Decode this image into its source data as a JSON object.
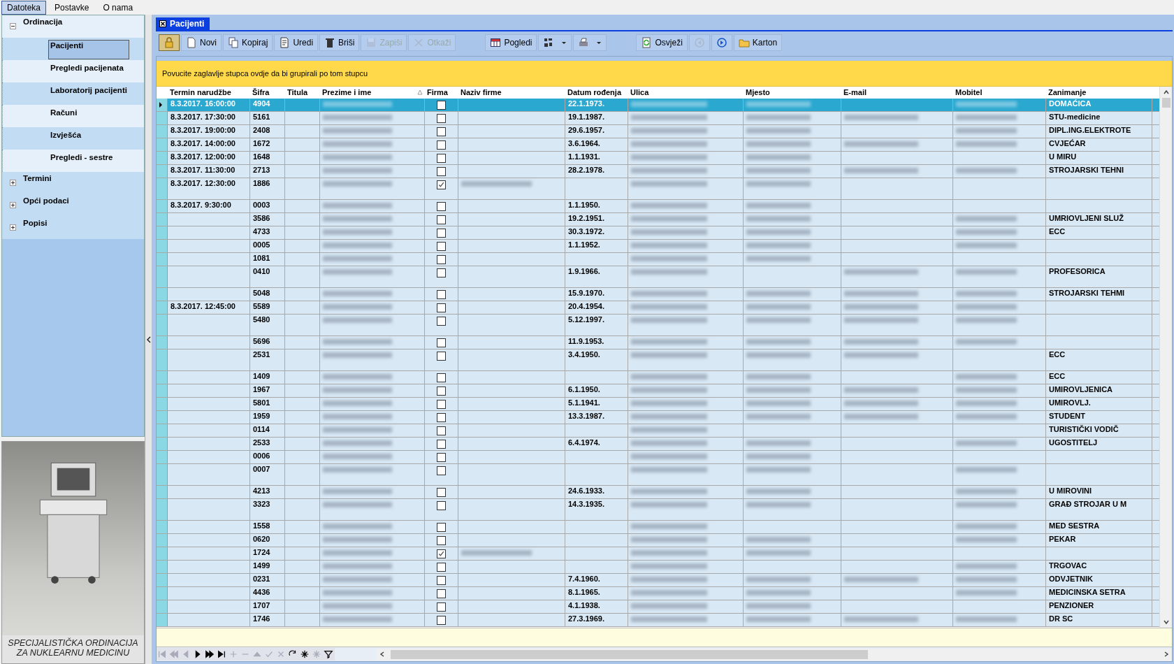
{
  "menu": [
    {
      "label": "Datoteka",
      "selected": true
    },
    {
      "label": "Postavke",
      "selected": false
    },
    {
      "label": "O nama",
      "selected": false
    }
  ],
  "tree": [
    {
      "label": "Ordinacija",
      "expanded": true,
      "children": [
        {
          "label": "Pacijenti",
          "selected": true
        },
        {
          "label": "Pregledi pacijenata",
          "selected": false
        },
        {
          "label": "Laboratorij pacijenti",
          "selected": false
        },
        {
          "label": "Računi",
          "selected": false
        },
        {
          "label": "Izvješća",
          "selected": false
        },
        {
          "label": "Pregledi - sestre",
          "selected": false
        }
      ]
    },
    {
      "label": "Termini",
      "expanded": false
    },
    {
      "label": "Opći podaci",
      "expanded": false
    },
    {
      "label": "Popisi",
      "expanded": false
    }
  ],
  "caption": "SPECIJALISTIČKA ORDINACIJA ZA NUKLEARNU MEDICINU",
  "tab": {
    "title": "Pacijenti"
  },
  "toolbar": [
    {
      "kind": "lock",
      "disabled": false,
      "pressed": true
    },
    {
      "kind": "new",
      "label": "Novi",
      "disabled": false,
      "pressed": false
    },
    {
      "kind": "copy",
      "label": "Kopiraj",
      "disabled": false,
      "pressed": false
    },
    {
      "kind": "edit",
      "label": "Uredi",
      "disabled": false,
      "pressed": false
    },
    {
      "kind": "delete",
      "label": "Briši",
      "disabled": false,
      "pressed": false
    },
    {
      "kind": "save",
      "label": "Zapiši",
      "disabled": true,
      "pressed": false
    },
    {
      "kind": "cancel",
      "label": "Otkaži",
      "disabled": true,
      "pressed": false
    },
    {
      "kind": "views",
      "label": "Pogledi",
      "disabled": false,
      "pressed": false
    },
    {
      "kind": "columns",
      "disabled": false,
      "pressed": false,
      "menu": true
    },
    {
      "kind": "print",
      "disabled": false,
      "pressed": false,
      "menu": true
    },
    {
      "kind": "refresh",
      "label": "Osvježi",
      "disabled": false,
      "pressed": false
    },
    {
      "kind": "prev",
      "disabled": true,
      "pressed": false
    },
    {
      "kind": "next",
      "disabled": false,
      "pressed": false
    },
    {
      "kind": "folder",
      "label": "Karton",
      "disabled": false,
      "pressed": false
    }
  ],
  "group_hint": "Povucite zaglavlje stupca ovdje da bi grupirali po tom stupcu",
  "columns": [
    {
      "label": "Termin narudžbe",
      "sorted": false
    },
    {
      "label": "Šifra",
      "sorted": false
    },
    {
      "label": "Titula",
      "sorted": false
    },
    {
      "label": "Prezime i ime",
      "sorted": true
    },
    {
      "label": "Firma",
      "sorted": false
    },
    {
      "label": "Naziv firme",
      "sorted": false
    },
    {
      "label": "Datum rođenja",
      "sorted": false
    },
    {
      "label": "Ulica",
      "sorted": false
    },
    {
      "label": "Mjesto",
      "sorted": false
    },
    {
      "label": "E-mail",
      "sorted": false
    },
    {
      "label": "Mobitel",
      "sorted": false
    },
    {
      "label": "Zanimanje",
      "sorted": false
    }
  ],
  "rows": [
    {
      "selected": true,
      "tall": false,
      "cells": [
        "8.3.2017. 16:00:00",
        "4904",
        null,
        {
          "redacted": true
        },
        {
          "checked": false
        },
        null,
        "22.1.1973.",
        {
          "redacted": true
        },
        {
          "redacted": true
        },
        null,
        {
          "redacted": true
        },
        "DOMAĆICA"
      ]
    },
    {
      "selected": false,
      "tall": false,
      "cells": [
        "8.3.2017. 17:30:00",
        "5161",
        null,
        {
          "redacted": true
        },
        {
          "checked": false
        },
        null,
        "19.1.1987.",
        {
          "redacted": true
        },
        {
          "redacted": true
        },
        {
          "redacted": true
        },
        {
          "redacted": true
        },
        "STU-medicine"
      ]
    },
    {
      "selected": false,
      "tall": false,
      "cells": [
        "8.3.2017. 19:00:00",
        "2408",
        null,
        {
          "redacted": true
        },
        {
          "checked": false
        },
        null,
        "29.6.1957.",
        {
          "redacted": true
        },
        {
          "redacted": true
        },
        null,
        {
          "redacted": true
        },
        "DIPL.ING.ELEKTROTE"
      ]
    },
    {
      "selected": false,
      "tall": false,
      "cells": [
        "8.3.2017. 14:00:00",
        "1672",
        null,
        {
          "redacted": true
        },
        {
          "checked": false
        },
        null,
        "3.6.1964.",
        {
          "redacted": true
        },
        {
          "redacted": true
        },
        {
          "redacted": true
        },
        {
          "redacted": true
        },
        "CVJEĆAR"
      ]
    },
    {
      "selected": false,
      "tall": false,
      "cells": [
        "8.3.2017. 12:00:00",
        "1648",
        null,
        {
          "redacted": true
        },
        {
          "checked": false
        },
        null,
        "1.1.1931.",
        {
          "redacted": true
        },
        {
          "redacted": true
        },
        null,
        null,
        "U MIRU"
      ]
    },
    {
      "selected": false,
      "tall": false,
      "cells": [
        "8.3.2017. 11:30:00",
        "2713",
        null,
        {
          "redacted": true
        },
        {
          "checked": false
        },
        null,
        "28.2.1978.",
        {
          "redacted": true
        },
        {
          "redacted": true
        },
        {
          "redacted": true
        },
        {
          "redacted": true
        },
        "STROJARSKI TEHNI"
      ]
    },
    {
      "selected": false,
      "tall": true,
      "cells": [
        "8.3.2017. 12:30:00",
        "1886",
        null,
        {
          "redacted": true
        },
        {
          "checked": true
        },
        {
          "redacted": true
        },
        null,
        {
          "redacted": true
        },
        {
          "redacted": true
        },
        null,
        null,
        null
      ]
    },
    {
      "selected": false,
      "tall": false,
      "cells": [
        "8.3.2017. 9:30:00",
        "0003",
        null,
        {
          "redacted": true
        },
        {
          "checked": false
        },
        null,
        "1.1.1950.",
        {
          "redacted": true
        },
        {
          "redacted": true
        },
        null,
        null,
        null
      ]
    },
    {
      "selected": false,
      "tall": false,
      "cells": [
        null,
        "3586",
        null,
        {
          "redacted": true
        },
        {
          "checked": false
        },
        null,
        "19.2.1951.",
        {
          "redacted": true
        },
        {
          "redacted": true
        },
        null,
        {
          "redacted": true
        },
        "UMRIOVLJENI SLUŽ"
      ]
    },
    {
      "selected": false,
      "tall": false,
      "cells": [
        null,
        "4733",
        null,
        {
          "redacted": true
        },
        {
          "checked": false
        },
        null,
        "30.3.1972.",
        {
          "redacted": true
        },
        {
          "redacted": true
        },
        null,
        {
          "redacted": true
        },
        "ECC"
      ]
    },
    {
      "selected": false,
      "tall": false,
      "cells": [
        null,
        "0005",
        null,
        {
          "redacted": true
        },
        {
          "checked": false
        },
        null,
        "1.1.1952.",
        {
          "redacted": true
        },
        {
          "redacted": true
        },
        null,
        {
          "redacted": true
        },
        null
      ]
    },
    {
      "selected": false,
      "tall": false,
      "cells": [
        null,
        "1081",
        null,
        {
          "redacted": true
        },
        {
          "checked": false
        },
        null,
        null,
        {
          "redacted": true
        },
        {
          "redacted": true
        },
        null,
        null,
        null
      ]
    },
    {
      "selected": false,
      "tall": true,
      "cells": [
        null,
        "0410",
        null,
        {
          "redacted": true
        },
        {
          "checked": false
        },
        null,
        "1.9.1966.",
        {
          "redacted": true
        },
        null,
        {
          "redacted": true
        },
        {
          "redacted": true
        },
        "PROFESORICA"
      ]
    },
    {
      "selected": false,
      "tall": false,
      "cells": [
        null,
        "5048",
        null,
        {
          "redacted": true
        },
        {
          "checked": false
        },
        null,
        "15.9.1970.",
        {
          "redacted": true
        },
        {
          "redacted": true
        },
        {
          "redacted": true
        },
        {
          "redacted": true
        },
        "STROJARSKI TEHMI"
      ]
    },
    {
      "selected": false,
      "tall": false,
      "cells": [
        "8.3.2017. 12:45:00",
        "5589",
        null,
        {
          "redacted": true
        },
        {
          "checked": false
        },
        null,
        "20.4.1954.",
        {
          "redacted": true
        },
        {
          "redacted": true
        },
        {
          "redacted": true
        },
        {
          "redacted": true
        },
        null
      ]
    },
    {
      "selected": false,
      "tall": true,
      "cells": [
        null,
        "5480",
        null,
        {
          "redacted": true
        },
        {
          "checked": false
        },
        null,
        "5.12.1997.",
        {
          "redacted": true
        },
        {
          "redacted": true
        },
        {
          "redacted": true
        },
        {
          "redacted": true
        },
        null
      ]
    },
    {
      "selected": false,
      "tall": false,
      "cells": [
        null,
        "5696",
        null,
        {
          "redacted": true
        },
        {
          "checked": false
        },
        null,
        "11.9.1953.",
        {
          "redacted": true
        },
        {
          "redacted": true
        },
        {
          "redacted": true
        },
        {
          "redacted": true
        },
        null
      ]
    },
    {
      "selected": false,
      "tall": true,
      "cells": [
        null,
        "2531",
        null,
        {
          "redacted": true
        },
        {
          "checked": false
        },
        null,
        "3.4.1950.",
        {
          "redacted": true
        },
        {
          "redacted": true
        },
        {
          "redacted": true
        },
        null,
        "ECC"
      ]
    },
    {
      "selected": false,
      "tall": false,
      "cells": [
        null,
        "1409",
        null,
        {
          "redacted": true
        },
        {
          "checked": false
        },
        null,
        null,
        {
          "redacted": true
        },
        {
          "redacted": true
        },
        null,
        {
          "redacted": true
        },
        "ECC"
      ]
    },
    {
      "selected": false,
      "tall": false,
      "cells": [
        null,
        "1967",
        null,
        {
          "redacted": true
        },
        {
          "checked": false
        },
        null,
        "6.1.1950.",
        {
          "redacted": true
        },
        {
          "redacted": true
        },
        {
          "redacted": true
        },
        {
          "redacted": true
        },
        "UMIROVLJENICA"
      ]
    },
    {
      "selected": false,
      "tall": false,
      "cells": [
        null,
        "5801",
        null,
        {
          "redacted": true
        },
        {
          "checked": false
        },
        null,
        "5.1.1941.",
        {
          "redacted": true
        },
        {
          "redacted": true
        },
        {
          "redacted": true
        },
        {
          "redacted": true
        },
        "UMIROVLJ."
      ]
    },
    {
      "selected": false,
      "tall": false,
      "cells": [
        null,
        "1959",
        null,
        {
          "redacted": true
        },
        {
          "checked": false
        },
        null,
        "13.3.1987.",
        {
          "redacted": true
        },
        {
          "redacted": true
        },
        {
          "redacted": true
        },
        {
          "redacted": true
        },
        "STUDENT"
      ]
    },
    {
      "selected": false,
      "tall": false,
      "cells": [
        null,
        "0114",
        null,
        {
          "redacted": true
        },
        {
          "checked": false
        },
        null,
        null,
        {
          "redacted": true
        },
        null,
        null,
        null,
        "TURISTIČKI VODIČ"
      ]
    },
    {
      "selected": false,
      "tall": false,
      "cells": [
        null,
        "2533",
        null,
        {
          "redacted": true
        },
        {
          "checked": false
        },
        null,
        "6.4.1974.",
        {
          "redacted": true
        },
        {
          "redacted": true
        },
        null,
        {
          "redacted": true
        },
        "UGOSTITELJ"
      ]
    },
    {
      "selected": false,
      "tall": false,
      "cells": [
        null,
        "0006",
        null,
        {
          "redacted": true
        },
        {
          "checked": false
        },
        null,
        null,
        {
          "redacted": true
        },
        {
          "redacted": true
        },
        null,
        null,
        null
      ]
    },
    {
      "selected": false,
      "tall": true,
      "cells": [
        null,
        "0007",
        null,
        {
          "redacted": true
        },
        {
          "checked": false
        },
        null,
        null,
        {
          "redacted": true
        },
        {
          "redacted": true
        },
        null,
        {
          "redacted": true
        },
        null
      ]
    },
    {
      "selected": false,
      "tall": false,
      "cells": [
        null,
        "4213",
        null,
        {
          "redacted": true
        },
        {
          "checked": false
        },
        null,
        "24.6.1933.",
        {
          "redacted": true
        },
        {
          "redacted": true
        },
        null,
        {
          "redacted": true
        },
        "U MIROVINI"
      ]
    },
    {
      "selected": false,
      "tall": true,
      "cells": [
        null,
        "3323",
        null,
        {
          "redacted": true
        },
        {
          "checked": false
        },
        null,
        "14.3.1935.",
        {
          "redacted": true
        },
        {
          "redacted": true
        },
        null,
        {
          "redacted": true
        },
        "GRAĐ STROJAR U M"
      ]
    },
    {
      "selected": false,
      "tall": false,
      "cells": [
        null,
        "1558",
        null,
        {
          "redacted": true
        },
        {
          "checked": false
        },
        null,
        null,
        {
          "redacted": true
        },
        null,
        null,
        {
          "redacted": true
        },
        "MED SESTRA"
      ]
    },
    {
      "selected": false,
      "tall": false,
      "cells": [
        null,
        "0620",
        null,
        {
          "redacted": true
        },
        {
          "checked": false
        },
        null,
        null,
        {
          "redacted": true
        },
        {
          "redacted": true
        },
        null,
        {
          "redacted": true
        },
        "PEKAR"
      ]
    },
    {
      "selected": false,
      "tall": false,
      "cells": [
        null,
        "1724",
        null,
        {
          "redacted": true
        },
        {
          "checked": true
        },
        {
          "redacted": true
        },
        null,
        {
          "redacted": true
        },
        {
          "redacted": true
        },
        null,
        null,
        null
      ]
    },
    {
      "selected": false,
      "tall": false,
      "cells": [
        null,
        "1499",
        null,
        {
          "redacted": true
        },
        {
          "checked": false
        },
        null,
        null,
        {
          "redacted": true
        },
        null,
        null,
        {
          "redacted": true
        },
        "TRGOVAC"
      ]
    },
    {
      "selected": false,
      "tall": false,
      "cells": [
        null,
        "0231",
        null,
        {
          "redacted": true
        },
        {
          "checked": false
        },
        null,
        "7.4.1960.",
        {
          "redacted": true
        },
        {
          "redacted": true
        },
        {
          "redacted": true
        },
        {
          "redacted": true
        },
        "ODVJETNIK"
      ]
    },
    {
      "selected": false,
      "tall": false,
      "cells": [
        null,
        "4436",
        null,
        {
          "redacted": true
        },
        {
          "checked": false
        },
        null,
        "8.1.1965.",
        {
          "redacted": true
        },
        {
          "redacted": true
        },
        null,
        {
          "redacted": true
        },
        "MEDICINSKA SETRA"
      ]
    },
    {
      "selected": false,
      "tall": false,
      "cells": [
        null,
        "1707",
        null,
        {
          "redacted": true
        },
        {
          "checked": false
        },
        null,
        "4.1.1938.",
        {
          "redacted": true
        },
        {
          "redacted": true
        },
        null,
        null,
        "PENZIONER"
      ]
    },
    {
      "selected": false,
      "tall": false,
      "cells": [
        null,
        "1746",
        null,
        {
          "redacted": true
        },
        {
          "checked": false
        },
        null,
        "27.3.1969.",
        {
          "redacted": true
        },
        {
          "redacted": true
        },
        {
          "redacted": true
        },
        {
          "redacted": true
        },
        "DR SC"
      ]
    }
  ],
  "navigator": [
    {
      "kind": "first",
      "disabled": true
    },
    {
      "kind": "prev-page",
      "disabled": true
    },
    {
      "kind": "prev",
      "disabled": true
    },
    {
      "kind": "next",
      "disabled": false
    },
    {
      "kind": "next-page",
      "disabled": false
    },
    {
      "kind": "last",
      "disabled": false
    },
    {
      "kind": "add",
      "disabled": true
    },
    {
      "kind": "remove",
      "disabled": true
    },
    {
      "kind": "up",
      "disabled": true
    },
    {
      "kind": "confirm",
      "disabled": true
    },
    {
      "kind": "cancel",
      "disabled": true
    },
    {
      "kind": "refresh",
      "disabled": false
    },
    {
      "kind": "star",
      "disabled": false
    },
    {
      "kind": "star",
      "disabled": true
    },
    {
      "kind": "filter",
      "disabled": false
    }
  ]
}
